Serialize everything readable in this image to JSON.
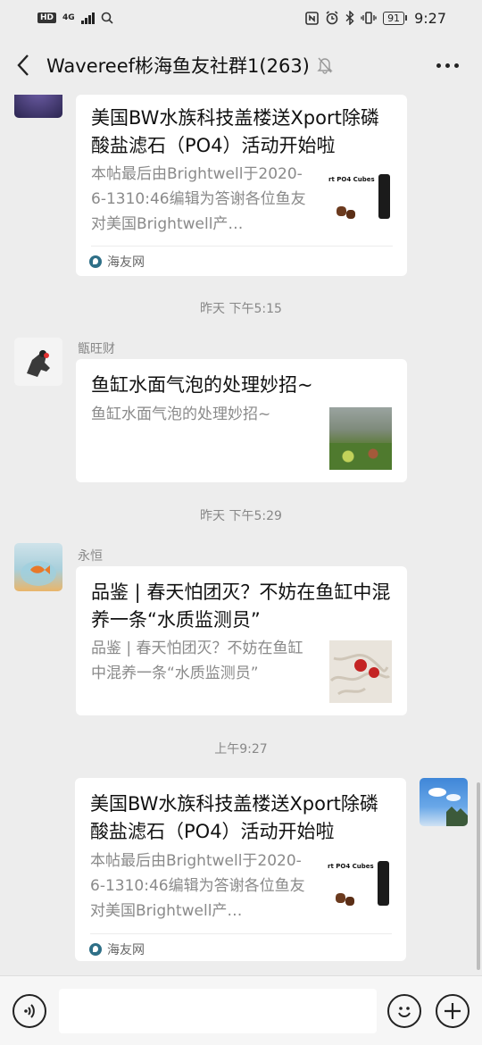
{
  "status_bar": {
    "hd_badge": "HD",
    "network": "4G",
    "battery": "91",
    "time": "9:27"
  },
  "header": {
    "title": "Wavereef彬海鱼友社群1(263)"
  },
  "messages": [
    {
      "title": "美国BW水族科技盖楼送Xport除磷酸盐滤石（PO4）活动开始啦",
      "desc": "本帖最后由Brightwell于2020-6-1310:46编辑为答谢各位鱼友对美国Brightwell产…",
      "thumb_text": "rt PO4 Cubes",
      "source": "海友网"
    },
    {
      "timestamp": "昨天 下午5:15",
      "sender": "甑旺财",
      "title": "鱼缸水面气泡的处理妙招~",
      "desc": "鱼缸水面气泡的处理妙招~"
    },
    {
      "timestamp": "昨天 下午5:29",
      "sender": "永恒",
      "title": "品鉴 | 春天怕团灭？不妨在鱼缸中混养一条“水质监测员”",
      "desc": "品鉴 | 春天怕团灭？不妨在鱼缸中混养一条“水质监测员”"
    },
    {
      "timestamp": "上午9:27",
      "title": "美国BW水族科技盖楼送Xport除磷酸盐滤石（PO4）活动开始啦",
      "desc": "本帖最后由Brightwell于2020-6-1310:46编辑为答谢各位鱼友对美国Brightwell产…",
      "thumb_text": "rt PO4 Cubes",
      "source": "海友网"
    }
  ],
  "input_bar": {
    "message_value": ""
  },
  "icons": [
    "back-icon",
    "mute-icon",
    "more-icon",
    "voice-icon",
    "emoji-icon",
    "add-icon",
    "source-logo-icon"
  ],
  "colors": {
    "background": "#ededed",
    "card": "#ffffff",
    "meta_text": "#888888",
    "source_logo": "#2e6f87"
  }
}
